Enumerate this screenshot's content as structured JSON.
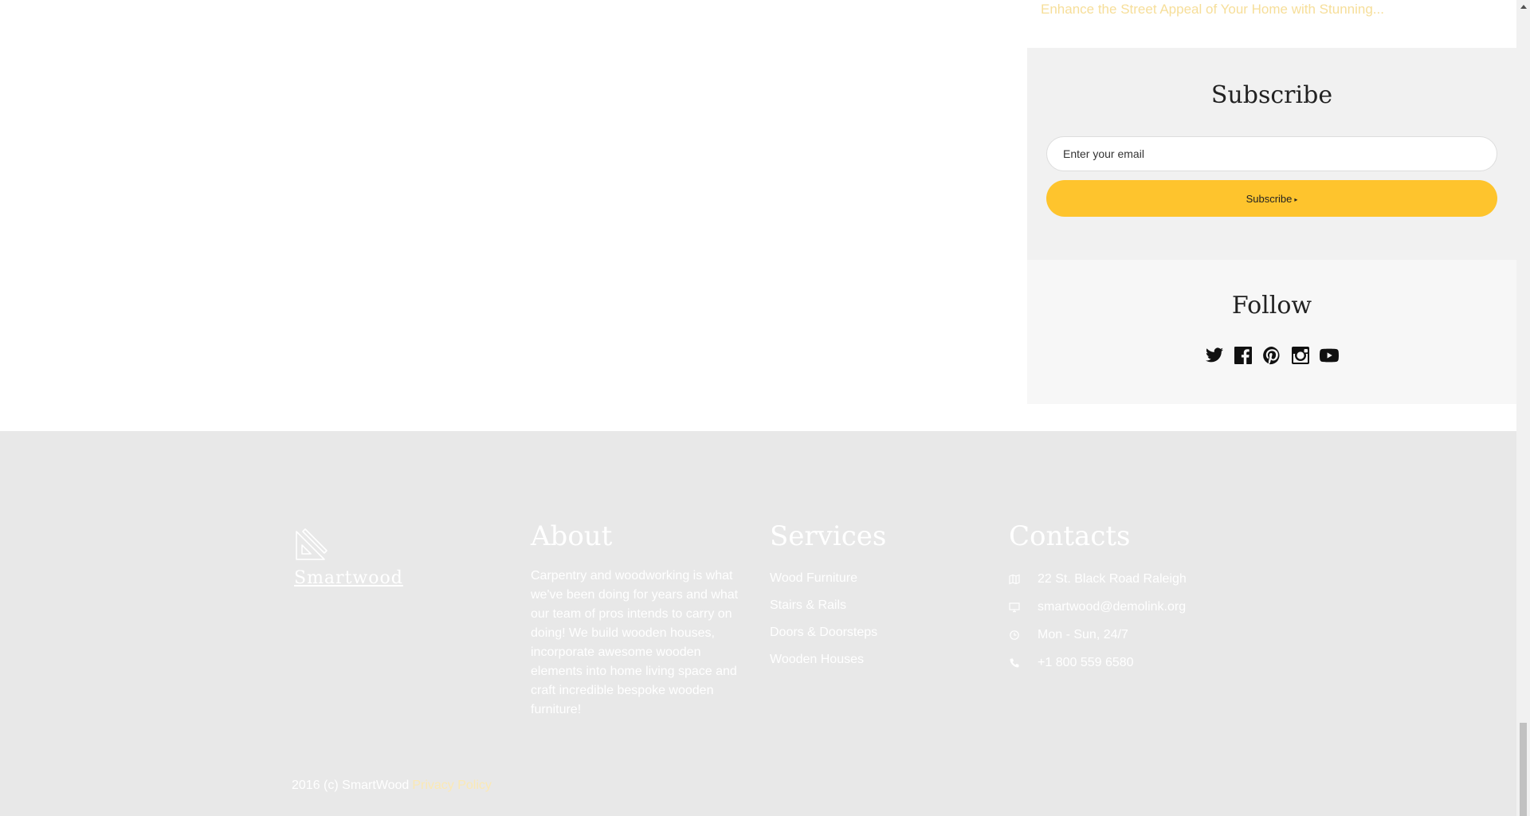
{
  "sidebar": {
    "top_link": "Enhance the Street Appeal of Your Home with Stunning...",
    "subscribe": {
      "title": "Subscribe",
      "email_placeholder": "Enter your email",
      "button_label": "Subscribe",
      "button_arrow": "▸"
    },
    "follow": {
      "title": "Follow",
      "icons": [
        "twitter-icon",
        "facebook-icon",
        "pinterest-icon",
        "instagram-icon",
        "youtube-icon"
      ]
    }
  },
  "footer": {
    "brand": "Smartwood",
    "about": {
      "title": "About",
      "text": "Carpentry and woodworking is what we've been doing for years and what our team of pros intends to carry on doing! We build wooden houses, incorporate awesome wooden elements into home living space and craft incredible bespoke wooden furniture!"
    },
    "services": {
      "title": "Services",
      "items": [
        "Wood Furniture",
        "Stairs & Rails",
        "Doors & Doorsteps",
        "Wooden Houses"
      ]
    },
    "contacts": {
      "title": "Contacts",
      "items": [
        {
          "icon": "map-icon",
          "text": "22 St. Black Road Raleigh"
        },
        {
          "icon": "monitor-icon",
          "text": "smartwood@demolink.org"
        },
        {
          "icon": "clock-icon",
          "text": "Mon - Sun, 24/7"
        },
        {
          "icon": "phone-icon",
          "text": "+1 800 559 6580"
        }
      ]
    },
    "copyright": "2016 (c) SmartWood",
    "privacy_label": "Privacy Policy"
  },
  "colors": {
    "accent": "#fec42d",
    "footer_bg": "#e8e8e8",
    "subscribe_bg": "#f1f1f1",
    "follow_bg": "#f7f7f7"
  }
}
